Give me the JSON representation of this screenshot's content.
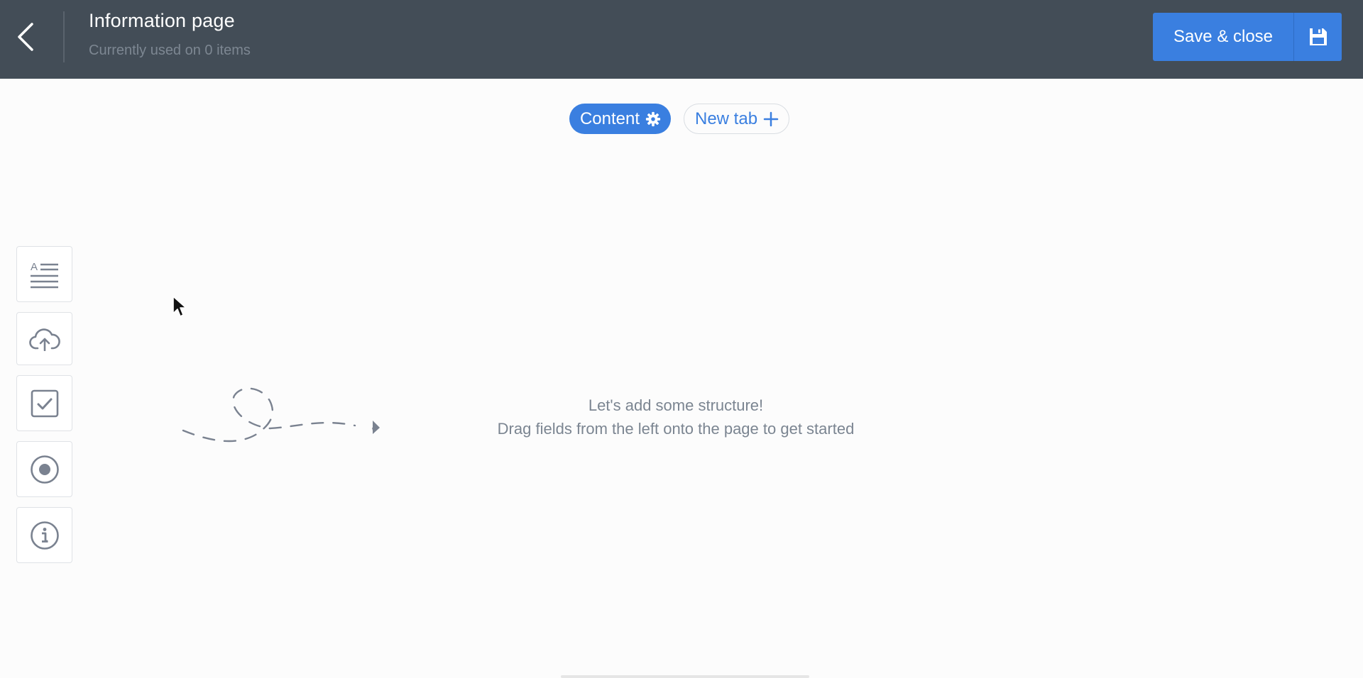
{
  "header": {
    "title": "Information page",
    "subtitle": "Currently used on 0 items",
    "save_close_label": "Save & close",
    "back_icon": "chevron-left-icon",
    "save_icon": "floppy-disk-icon"
  },
  "tabs": [
    {
      "label": "Content",
      "icon": "gear-icon",
      "active": true
    },
    {
      "label": "New tab",
      "icon": "plus-icon",
      "active": false
    }
  ],
  "field_palette": [
    {
      "icon": "text-field-icon"
    },
    {
      "icon": "cloud-upload-icon"
    },
    {
      "icon": "checkbox-icon"
    },
    {
      "icon": "radio-button-icon"
    },
    {
      "icon": "info-icon"
    }
  ],
  "empty_state": {
    "line1": "Let's add some structure!",
    "line2": "Drag fields from the left onto the page to get started"
  },
  "colors": {
    "header_bg": "#434d57",
    "accent": "#3a7fe0",
    "icon_gray": "#7a8290",
    "page_bg": "#fcfcfc"
  }
}
